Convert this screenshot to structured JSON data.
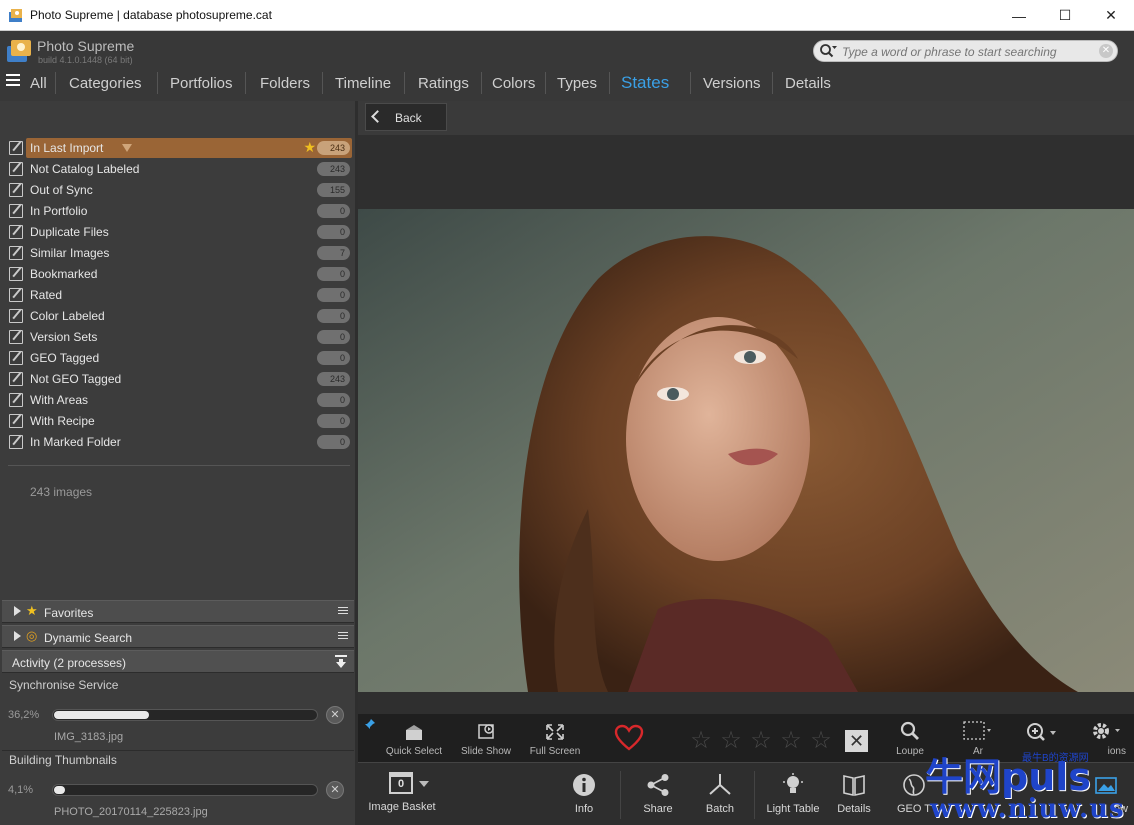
{
  "window": {
    "title": "Photo Supreme | database photosupreme.cat",
    "minimize": "—",
    "maximize": "☐",
    "close": "✕"
  },
  "app": {
    "name": "Photo Supreme",
    "build": "build 4.1.0.1448 (64 bit)"
  },
  "search": {
    "placeholder": "Type a word or phrase to start searching"
  },
  "nav": {
    "tabs": [
      "All",
      "Categories",
      "Portfolios",
      "Folders",
      "Timeline",
      "Ratings",
      "Colors",
      "Types",
      "States",
      "Versions",
      "Details"
    ],
    "active": "States"
  },
  "states": [
    {
      "label": "In Last Import",
      "count": "243"
    },
    {
      "label": "Not Catalog Labeled",
      "count": "243"
    },
    {
      "label": "Out of Sync",
      "count": "155"
    },
    {
      "label": "In Portfolio",
      "count": "0"
    },
    {
      "label": "Duplicate Files",
      "count": "0"
    },
    {
      "label": "Similar Images",
      "count": "7"
    },
    {
      "label": "Bookmarked",
      "count": "0"
    },
    {
      "label": "Rated",
      "count": "0"
    },
    {
      "label": "Color Labeled",
      "count": "0"
    },
    {
      "label": "Version Sets",
      "count": "0"
    },
    {
      "label": "GEO Tagged",
      "count": "0"
    },
    {
      "label": "Not GEO Tagged",
      "count": "243"
    },
    {
      "label": "With Areas",
      "count": "0"
    },
    {
      "label": "With Recipe",
      "count": "0"
    },
    {
      "label": "In Marked Folder",
      "count": "0"
    }
  ],
  "image_count": "243 images",
  "panels": {
    "favorites": "Favorites",
    "dynamic_search": "Dynamic Search",
    "activity": "Activity (2 processes)"
  },
  "processes": [
    {
      "title": "Synchronise Service",
      "percent": "36,2%",
      "progress": 0.362,
      "file": "IMG_3183.jpg"
    },
    {
      "title": "Building Thumbnails",
      "percent": "4,1%",
      "progress": 0.041,
      "file": "PHOTO_20170114_225823.jpg"
    }
  ],
  "viewer": {
    "back": "Back"
  },
  "toolbar_top": {
    "quick_select": "Quick Select",
    "slide_show": "Slide Show",
    "full_screen": "Full Screen",
    "loupe": "Loupe",
    "areas": "Ar",
    "options": "ions",
    "rating": 0,
    "max_rating": 5,
    "star_glyph": "☆",
    "reject_glyph": "✕"
  },
  "toolbar_bottom": {
    "basket_count": "0",
    "image_basket": "Image Basket",
    "info": "Info",
    "share": "Share",
    "batch": "Batch",
    "light_table": "Light Table",
    "details": "Details",
    "geo_tag": "GEO T",
    "view": "ew"
  },
  "watermark": {
    "brand": "牛网puls",
    "tagline": "最牛B的资源网",
    "url": "www.niuw.us"
  },
  "colors": {
    "accent": "#3aa0e6",
    "selected_row": "#9a6536",
    "heart": "#d8282b",
    "star": "#f0c020"
  }
}
